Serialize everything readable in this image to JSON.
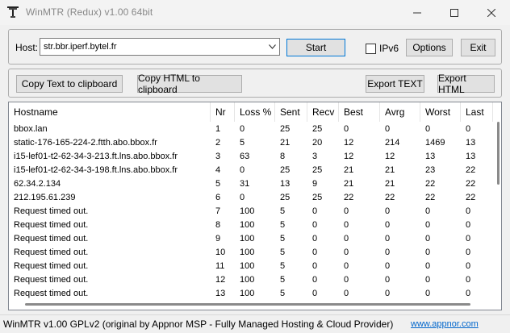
{
  "window": {
    "title": "WinMTR (Redux) v1.00 64bit"
  },
  "toolbar": {
    "host_label": "Host:",
    "host_value": "str.bbr.iperf.bytel.fr",
    "start_label": "Start",
    "ipv6_label": "IPv6",
    "ipv6_checked": false,
    "options_label": "Options",
    "exit_label": "Exit"
  },
  "actions": {
    "copy_text_label": "Copy Text to clipboard",
    "copy_html_label": "Copy HTML to clipboard",
    "export_text_label": "Export TEXT",
    "export_html_label": "Export HTML"
  },
  "table": {
    "columns": [
      "Hostname",
      "Nr",
      "Loss %",
      "Sent",
      "Recv",
      "Best",
      "Avrg",
      "Worst",
      "Last"
    ],
    "rows": [
      [
        "bbox.lan",
        "1",
        "0",
        "25",
        "25",
        "0",
        "0",
        "0",
        "0"
      ],
      [
        "static-176-165-224-2.ftth.abo.bbox.fr",
        "2",
        "5",
        "21",
        "20",
        "12",
        "214",
        "1469",
        "13"
      ],
      [
        "i15-lef01-t2-62-34-3-213.ft.lns.abo.bbox.fr",
        "3",
        "63",
        "8",
        "3",
        "12",
        "12",
        "13",
        "13"
      ],
      [
        "i15-lef01-t2-62-34-3-198.ft.lns.abo.bbox.fr",
        "4",
        "0",
        "25",
        "25",
        "21",
        "21",
        "23",
        "22"
      ],
      [
        "62.34.2.134",
        "5",
        "31",
        "13",
        "9",
        "21",
        "21",
        "22",
        "22"
      ],
      [
        "212.195.61.239",
        "6",
        "0",
        "25",
        "25",
        "22",
        "22",
        "22",
        "22"
      ],
      [
        "Request timed out.",
        "7",
        "100",
        "5",
        "0",
        "0",
        "0",
        "0",
        "0"
      ],
      [
        "Request timed out.",
        "8",
        "100",
        "5",
        "0",
        "0",
        "0",
        "0",
        "0"
      ],
      [
        "Request timed out.",
        "9",
        "100",
        "5",
        "0",
        "0",
        "0",
        "0",
        "0"
      ],
      [
        "Request timed out.",
        "10",
        "100",
        "5",
        "0",
        "0",
        "0",
        "0",
        "0"
      ],
      [
        "Request timed out.",
        "11",
        "100",
        "5",
        "0",
        "0",
        "0",
        "0",
        "0"
      ],
      [
        "Request timed out.",
        "12",
        "100",
        "5",
        "0",
        "0",
        "0",
        "0",
        "0"
      ],
      [
        "Request timed out.",
        "13",
        "100",
        "5",
        "0",
        "0",
        "0",
        "0",
        "0"
      ]
    ]
  },
  "status": {
    "text": "WinMTR v1.00 GPLv2 (original by Appnor MSP - Fully Managed Hosting & Cloud Provider)",
    "link": "www.appnor.com"
  },
  "icons": {
    "app": "network-tower-icon",
    "minimize": "minimize-icon",
    "maximize": "maximize-icon",
    "close": "close-icon",
    "dropdown": "chevron-down-icon"
  },
  "colors": {
    "link": "#0066cc",
    "focus": "#0078d7"
  }
}
